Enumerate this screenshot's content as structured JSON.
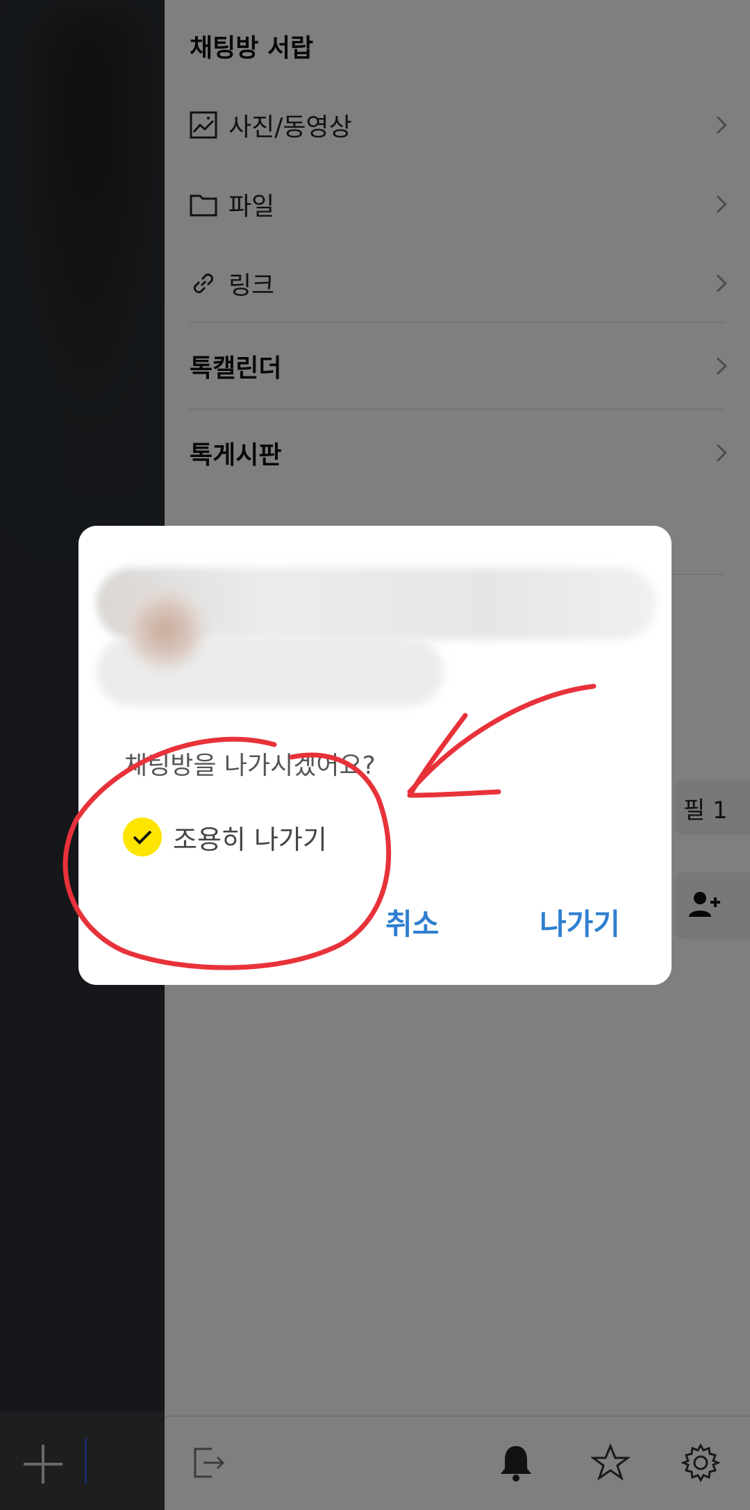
{
  "drawer": {
    "section_title": "채팅방 서랍",
    "media_items": [
      {
        "label": "사진/동영상",
        "icon": "image-icon"
      },
      {
        "label": "파일",
        "icon": "folder-icon"
      },
      {
        "label": "링크",
        "icon": "link-icon"
      }
    ],
    "talk_calendar": "톡캘린더",
    "talk_board": "톡게시판",
    "profile_chip": "필 1"
  },
  "dialog": {
    "question": "채팅방을 나가시겠어요?",
    "quiet_exit_label": "조용히 나가기",
    "quiet_exit_checked": true,
    "cancel_label": "취소",
    "exit_label": "나가기"
  },
  "colors": {
    "accent_blue": "#2f7fd0",
    "kakao_yellow": "#fee500",
    "annotation_red": "#e8323a"
  },
  "bottom_bar_icons": [
    "exit-icon",
    "bell-icon",
    "star-icon",
    "settings-icon"
  ]
}
